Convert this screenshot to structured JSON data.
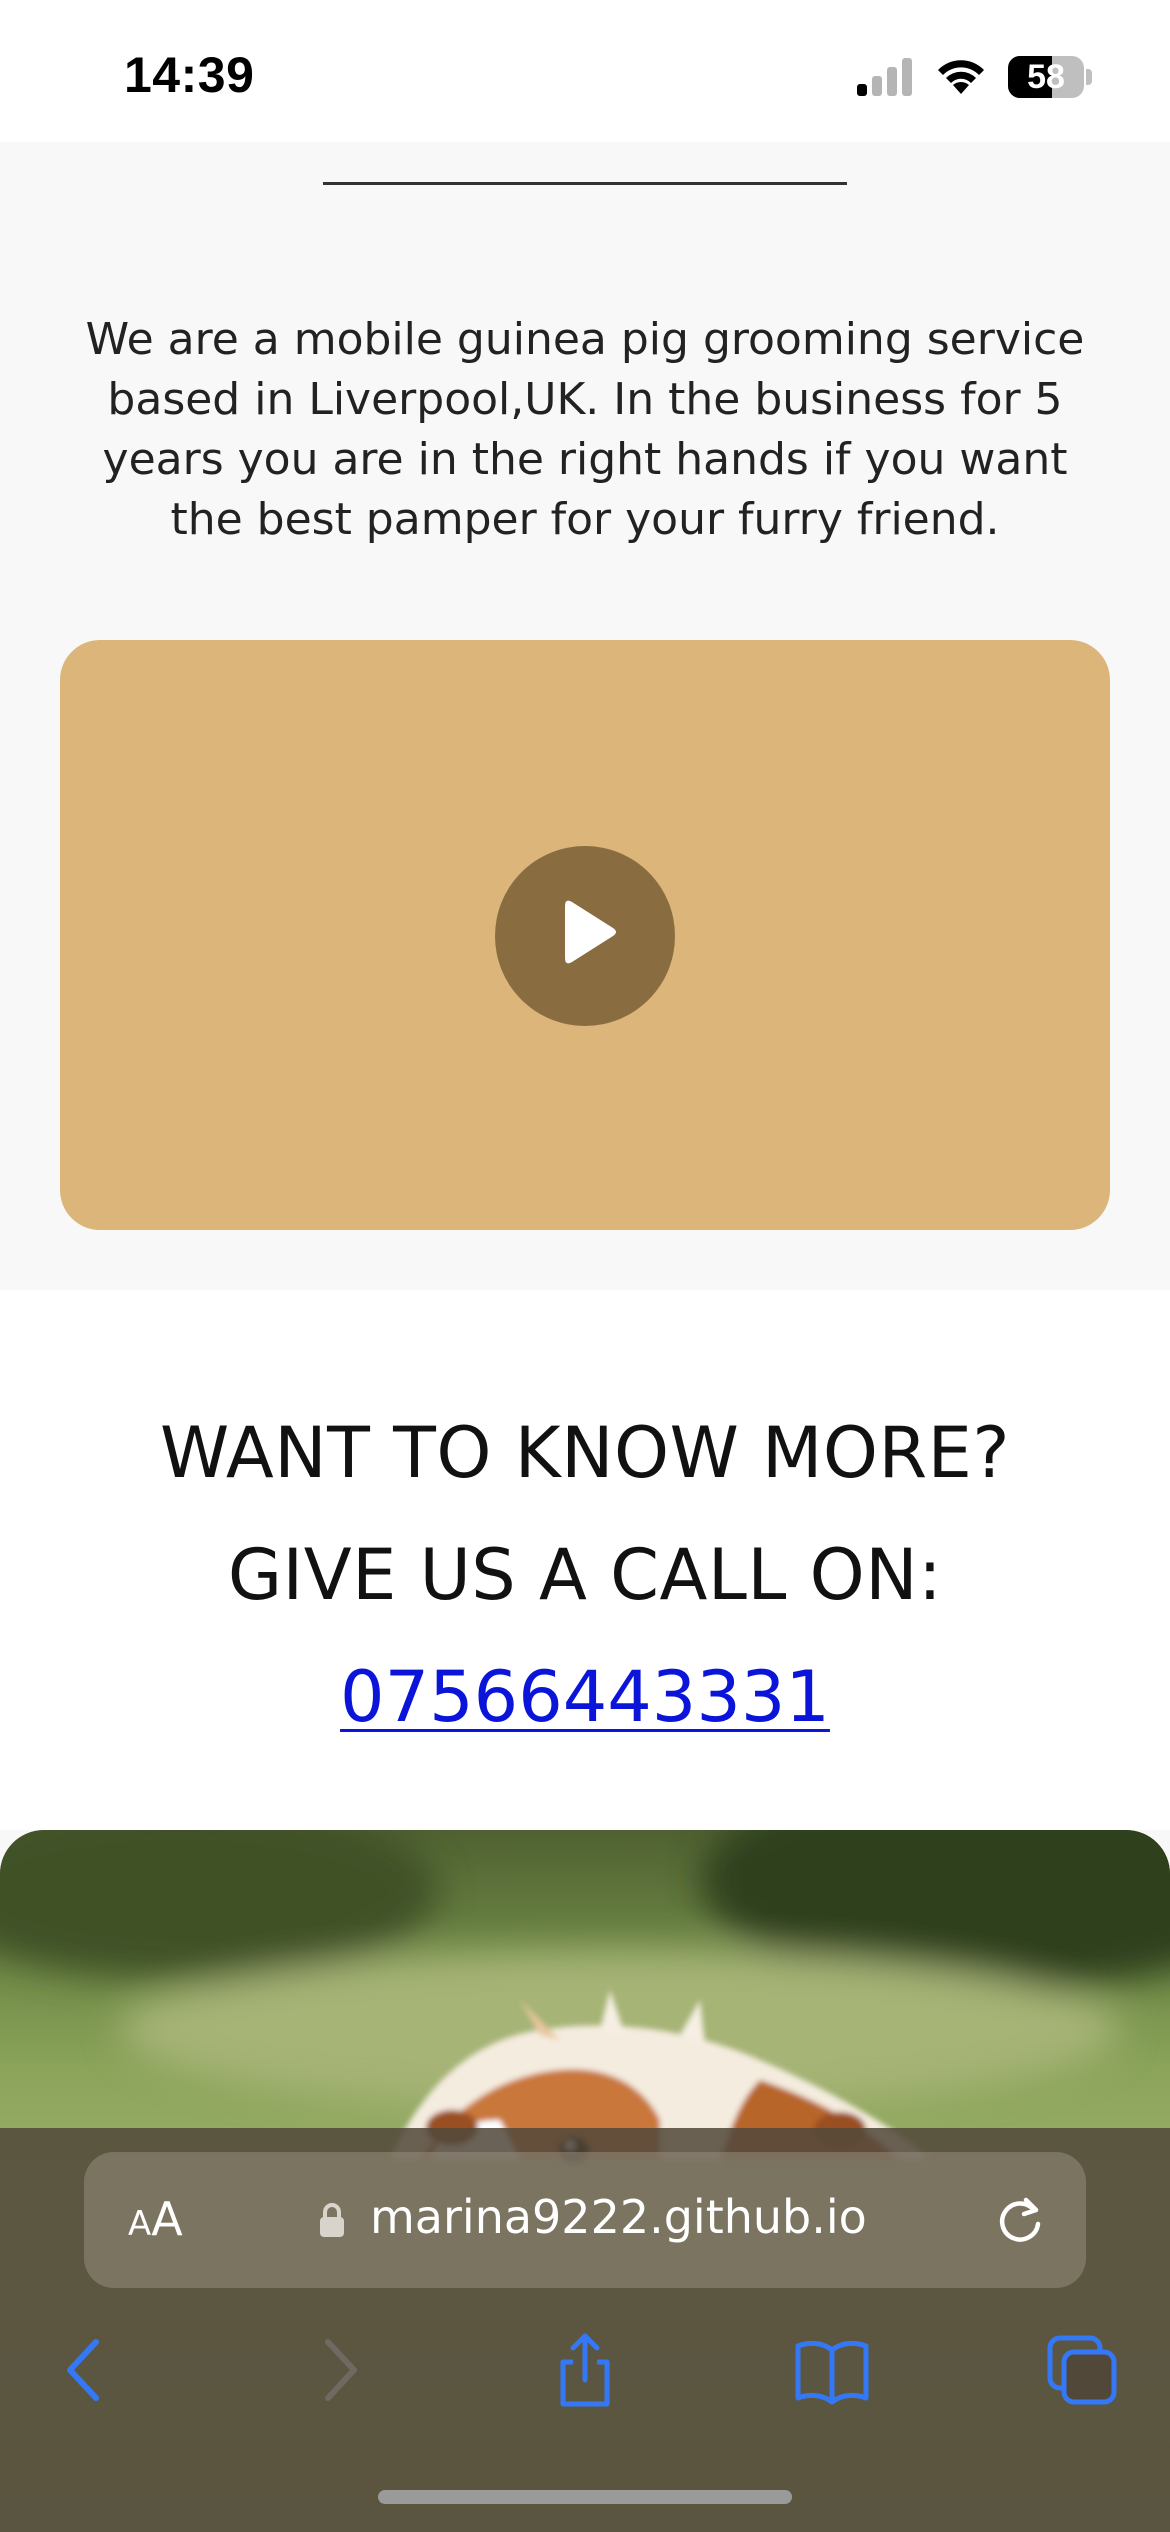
{
  "status_bar": {
    "time": "14:39",
    "battery_level": "58",
    "battery_fraction": 0.58
  },
  "about": {
    "intro_text": "We are a mobile guinea pig grooming service based in Liverpool,UK. In the business for 5 years you are in the right hands if you want the best pamper for your furry friend.",
    "video_color": "#dbb579"
  },
  "contact": {
    "line1": "WANT TO KNOW MORE?",
    "line2": "GIVE US A CALL ON:",
    "phone": "07566443331"
  },
  "browser": {
    "aa_small": "A",
    "aa_big": "A",
    "url": "marina9222.github.io",
    "accent_color": "#3478f6",
    "icons": [
      "back-icon",
      "forward-icon",
      "share-icon",
      "bookmarks-icon",
      "tabs-icon",
      "reload-icon",
      "lock-icon"
    ]
  }
}
